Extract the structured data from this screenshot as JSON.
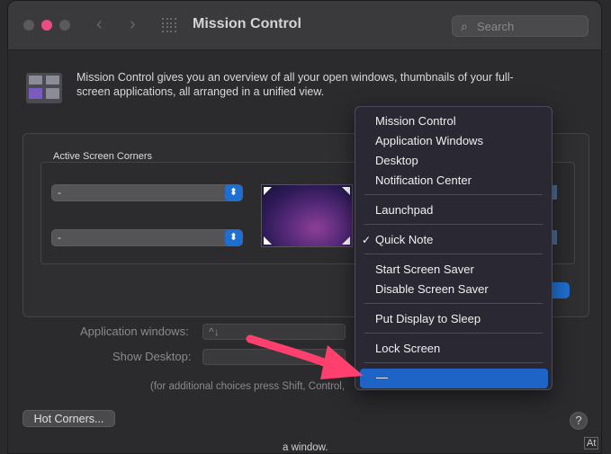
{
  "window": {
    "title": "Mission Control",
    "search_placeholder": "Search",
    "nav_back": "‹",
    "nav_forward": "›"
  },
  "description": "Mission Control gives you an overview of all your open windows, thumbnails of your full-screen applications, all arranged in a unified view.",
  "corners": {
    "section_label": "Active Screen Corners",
    "top_left_value": "-",
    "bottom_left_value": "-"
  },
  "options": {
    "app_windows_label": "Application windows:",
    "app_windows_value": "^↓",
    "show_desktop_label": "Show Desktop:",
    "note": "(for additional choices press Shift, Control,"
  },
  "buttons": {
    "hot_corners": "Hot Corners...",
    "help": "?"
  },
  "tooltip": {
    "bottom_text": "a window.",
    "right_text": "At"
  },
  "menu": {
    "items": [
      {
        "label": "Mission Control"
      },
      {
        "label": "Application Windows"
      },
      {
        "label": "Desktop"
      },
      {
        "label": "Notification Center"
      },
      {
        "label": "Launchpad"
      },
      {
        "label": "Quick Note",
        "checked": true
      },
      {
        "label": "Start Screen Saver"
      },
      {
        "label": "Disable Screen Saver"
      },
      {
        "label": "Put Display to Sleep"
      },
      {
        "label": "Lock Screen"
      },
      {
        "label": "—",
        "highlighted": true
      }
    ],
    "check_glyph": "✓"
  },
  "colors": {
    "accent_blue": "#1d64c6",
    "arrow_pink": "#ff3f6e",
    "close_dot": "#ec4b84"
  }
}
